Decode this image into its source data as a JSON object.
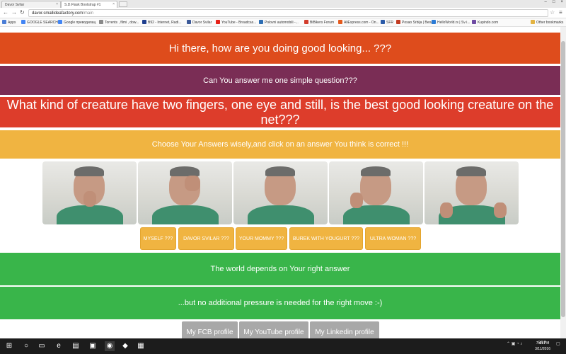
{
  "browser": {
    "tabs": [
      {
        "label": "Davor Svilar"
      },
      {
        "label": "S.D.Flask Bootstrap #1"
      }
    ],
    "url_host": "davor.smallideafactory.com",
    "url_path": "/main",
    "bookmarks": [
      {
        "label": "Apps",
        "color": "#4a7dd6"
      },
      {
        "label": "GOOGLE SEARCH",
        "color": "#4285f4"
      },
      {
        "label": "Google преводилац",
        "color": "#4285f4"
      },
      {
        "label": "Torrents , filmi , dow...",
        "color": "#888888"
      },
      {
        "label": "B92 - Internet, Radi...",
        "color": "#1f3f8f"
      },
      {
        "label": "Davor Svilar",
        "color": "#3b5998"
      },
      {
        "label": "YouTube - Broadcas...",
        "color": "#e62117"
      },
      {
        "label": "Polovni automobili -...",
        "color": "#2c6db3"
      },
      {
        "label": "BiBikers Forum",
        "color": "#d23c2b"
      },
      {
        "label": "AliExpress.com - On...",
        "color": "#e45a1d"
      },
      {
        "label": "SFR",
        "color": "#2a5aa8"
      },
      {
        "label": "Posao Srbija | Beogr...",
        "color": "#c23b22"
      },
      {
        "label": "HelloWorld.rs | Sv i...",
        "color": "#2b7bd6"
      },
      {
        "label": "Kupindo.com",
        "color": "#6e4aa3"
      }
    ],
    "other_bookmarks": "Other bookmarks"
  },
  "page": {
    "greeting": "Hi there, how are you doing good looking... ???",
    "question_intro": "Can You answer me one simple question???",
    "question": "What kind of creature have two fingers, one eye and still, is the best good looking creature on the net???",
    "instruction": "Choose Your Answers wisely,and click on an answer You think is correct !!!",
    "answers": [
      {
        "label": "MYSELF ???"
      },
      {
        "label": "DAVOR SVILAR ???"
      },
      {
        "label": "YOUR MOMMY ???"
      },
      {
        "label": "BUREK WITH YOUGURT ???"
      },
      {
        "label": "ULTRA WOMAN ???"
      }
    ],
    "world_text": "The world depends on Your right answer",
    "pressure_text": "...but no additional pressure is needed for the right move :-)",
    "profiles": [
      {
        "label": "My FCB profile"
      },
      {
        "label": "My YouTube profile"
      },
      {
        "label": "My Linkedin profile"
      }
    ],
    "colors": {
      "orange": "#de4c1c",
      "purple": "#7a2d55",
      "red": "#dd3d2b",
      "yellow": "#f0b441",
      "green": "#39b54a",
      "gray": "#a8a8a8"
    }
  },
  "taskbar": {
    "time": "7:41 PM",
    "date": "3/11/2016",
    "language": "SRP"
  }
}
